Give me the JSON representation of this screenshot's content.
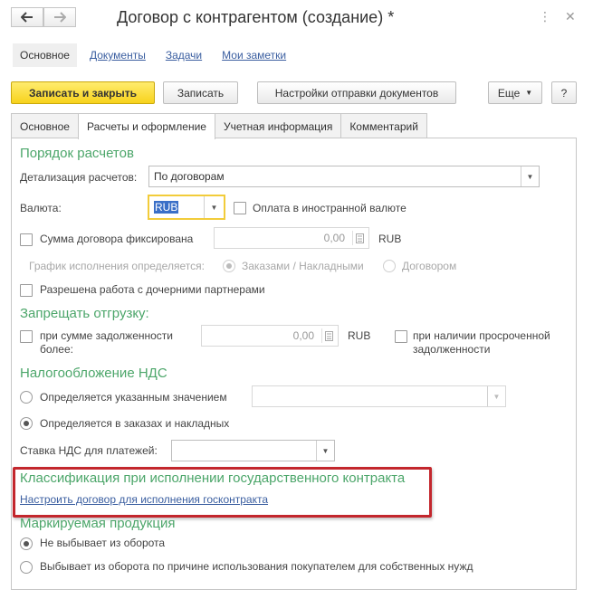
{
  "window": {
    "title": "Договор с контрагентом (создание) *"
  },
  "nav_links": [
    {
      "label": "Основное",
      "active": true
    },
    {
      "label": "Документы",
      "active": false
    },
    {
      "label": "Задачи",
      "active": false
    },
    {
      "label": "Мои заметки",
      "active": false
    }
  ],
  "toolbar": {
    "save_close_label": "Записать и закрыть",
    "save_label": "Записать",
    "send_settings_label": "Настройки отправки документов",
    "more_label": "Еще",
    "help_label": "?"
  },
  "tabs": [
    {
      "label": "Основное",
      "active": false
    },
    {
      "label": "Расчеты и оформление",
      "active": true
    },
    {
      "label": "Учетная информация",
      "active": false
    },
    {
      "label": "Комментарий",
      "active": false
    }
  ],
  "settlement": {
    "section_title": "Порядок расчетов",
    "detail_label": "Детализация расчетов:",
    "detail_value": "По договорам",
    "currency_label": "Валюта:",
    "currency_value": "RUB",
    "foreign_currency_label": "Оплата в иностранной валюте",
    "fixed_sum_label": "Сумма договора фиксирована",
    "fixed_sum_value": "0,00",
    "fixed_sum_currency": "RUB",
    "schedule_label": "График исполнения определяется:",
    "schedule_option1": "Заказами / Накладными",
    "schedule_option2": "Договором",
    "subsidiaries_label": "Разрешена работа с дочерними партнерами"
  },
  "shipment_ban": {
    "section_title": "Запрещать отгрузку:",
    "debt_label_line1": "при сумме задолженности",
    "debt_label_line2": "более:",
    "debt_value": "0,00",
    "debt_currency": "RUB",
    "overdue_label_line1": "при наличии просроченной",
    "overdue_label_line2": "задолженности"
  },
  "vat": {
    "section_title": "Налогообложение НДС",
    "option_specified": "Определяется указанным значением",
    "option_orders": "Определяется в заказах и накладных",
    "selected": "orders",
    "rate_label": "Ставка НДС для платежей:",
    "rate_value": ""
  },
  "gov_contract": {
    "section_title": "Классификация при исполнении государственного контракта",
    "link_label": "Настроить договор для исполнения госконтракта"
  },
  "marking": {
    "section_title": "Маркируемая продукция",
    "option_not_removed": "Не выбывает из оборота",
    "option_removed": "Выбывает из оборота по причине использования покупателем для собственных нужд",
    "selected": "not_removed"
  },
  "colors": {
    "section_green": "#4ca66a",
    "link_blue": "#3a5ea0",
    "primary_yellow": "#f7d21c",
    "highlight_red": "#c3272d"
  }
}
